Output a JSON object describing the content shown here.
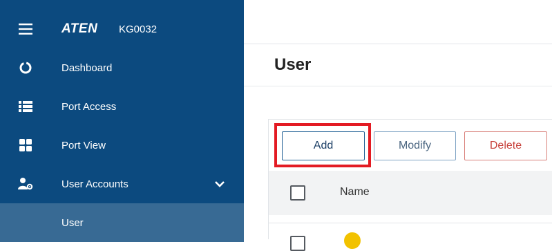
{
  "app": {
    "logo": "ATEN",
    "model": "KG0032"
  },
  "sidebar": {
    "items": [
      {
        "label": "Dashboard",
        "icon": "dashboard-ring-icon"
      },
      {
        "label": "Port Access",
        "icon": "list-icon"
      },
      {
        "label": "Port View",
        "icon": "grid-icon"
      },
      {
        "label": "User Accounts",
        "icon": "user-settings-icon",
        "expanded": true
      },
      {
        "label": "User",
        "active": true
      }
    ]
  },
  "main": {
    "title": "User",
    "toolbar": {
      "add_label": "Add",
      "modify_label": "Modify",
      "delete_label": "Delete"
    },
    "table": {
      "columns": [
        "Name"
      ]
    }
  },
  "colors": {
    "sidebar_bg": "#0c4a7f",
    "sidebar_active": "#386a94",
    "highlight": "#e31b23",
    "delete": "#c8423c"
  }
}
